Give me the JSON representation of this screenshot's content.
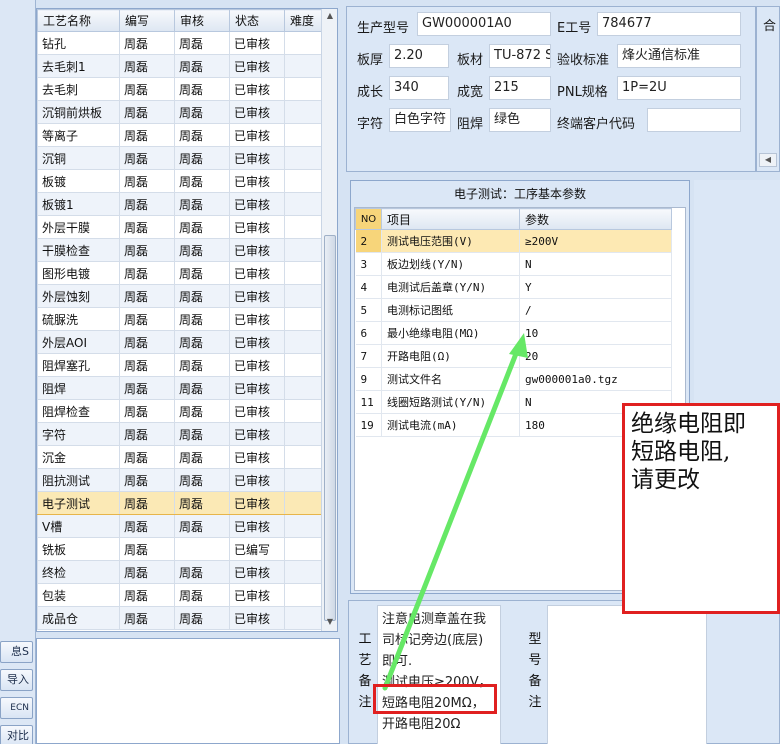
{
  "side_buttons": [
    "息S",
    "导入",
    "ECN",
    "对比"
  ],
  "process_table": {
    "headers": [
      "工艺名称",
      "编写",
      "审核",
      "状态",
      "难度"
    ],
    "rows": [
      [
        "钻孔",
        "周磊",
        "周磊",
        "已审核",
        ""
      ],
      [
        "去毛刺1",
        "周磊",
        "周磊",
        "已审核",
        ""
      ],
      [
        "去毛刺",
        "周磊",
        "周磊",
        "已审核",
        ""
      ],
      [
        "沉铜前烘板",
        "周磊",
        "周磊",
        "已审核",
        ""
      ],
      [
        "等离子",
        "周磊",
        "周磊",
        "已审核",
        ""
      ],
      [
        "沉铜",
        "周磊",
        "周磊",
        "已审核",
        ""
      ],
      [
        "板镀",
        "周磊",
        "周磊",
        "已审核",
        ""
      ],
      [
        "板镀1",
        "周磊",
        "周磊",
        "已审核",
        ""
      ],
      [
        "外层干膜",
        "周磊",
        "周磊",
        "已审核",
        ""
      ],
      [
        "干膜检查",
        "周磊",
        "周磊",
        "已审核",
        ""
      ],
      [
        "图形电镀",
        "周磊",
        "周磊",
        "已审核",
        ""
      ],
      [
        "外层蚀刻",
        "周磊",
        "周磊",
        "已审核",
        ""
      ],
      [
        "硫脲洗",
        "周磊",
        "周磊",
        "已审核",
        ""
      ],
      [
        "外层AOI",
        "周磊",
        "周磊",
        "已审核",
        ""
      ],
      [
        "阻焊塞孔",
        "周磊",
        "周磊",
        "已审核",
        ""
      ],
      [
        "阻焊",
        "周磊",
        "周磊",
        "已审核",
        ""
      ],
      [
        "阻焊检查",
        "周磊",
        "周磊",
        "已审核",
        ""
      ],
      [
        "字符",
        "周磊",
        "周磊",
        "已审核",
        ""
      ],
      [
        "沉金",
        "周磊",
        "周磊",
        "已审核",
        ""
      ],
      [
        "阻抗测试",
        "周磊",
        "周磊",
        "已审核",
        ""
      ],
      [
        "电子测试",
        "周磊",
        "周磊",
        "已审核",
        ""
      ],
      [
        "V槽",
        "周磊",
        "周磊",
        "已审核",
        ""
      ],
      [
        "铣板",
        "周磊",
        "",
        "已编写",
        ""
      ],
      [
        "终检",
        "周磊",
        "周磊",
        "已审核",
        ""
      ],
      [
        "包装",
        "周磊",
        "周磊",
        "已审核",
        ""
      ],
      [
        "成品仓",
        "周磊",
        "周磊",
        "已审核",
        ""
      ]
    ],
    "selected_index": 20
  },
  "info": {
    "model_label": "生产型号",
    "model_value": "GW000001A0",
    "eno_label": "E工号",
    "eno_value": "784677",
    "thick_label": "板厚",
    "thick_value": "2.20",
    "material_label": "板材",
    "material_value": "TU-872 S",
    "standard_label": "验收标准",
    "standard_value": "烽火通信标准",
    "length_label": "成长",
    "length_value": "340",
    "width_label": "成宽",
    "width_value": "215",
    "pnl_label": "PNL规格",
    "pnl_value": "1P=2U",
    "char_label": "字符",
    "char_value": "白色字符",
    "mask_label": "阻焊",
    "mask_value": "绿色",
    "customer_label": "终端客户代码",
    "customer_value": "",
    "cut_label": "合"
  },
  "electronic_test": {
    "title": "电子测试：工序基本参数",
    "headers": [
      "NO",
      "项目",
      "参数"
    ],
    "rows": [
      [
        "2",
        "测试电压范围(V)",
        "≥200V"
      ],
      [
        "3",
        "板边划线(Y/N)",
        "N"
      ],
      [
        "4",
        "电测试后盖章(Y/N)",
        "Y"
      ],
      [
        "5",
        "电测标记图纸",
        "/"
      ],
      [
        "6",
        "最小绝缘电阻(MΩ)",
        "10"
      ],
      [
        "7",
        "开路电阻(Ω)",
        "20"
      ],
      [
        "9",
        "测试文件名",
        "gw000001a0.tgz"
      ],
      [
        "11",
        "线圈短路测试(Y/N)",
        "N"
      ],
      [
        "19",
        "测试电流(mA)",
        "180"
      ]
    ],
    "current_index": 0
  },
  "notes": {
    "process_note_label": [
      "工",
      "艺",
      "备",
      "注"
    ],
    "process_note_lines": [
      "注意电测章盖在我",
      "司标记旁边(底层)",
      "即可.",
      "测试电压≥200V，",
      "短路电阻20MΩ，",
      "开路电阻20Ω"
    ],
    "type_note_label": [
      "型",
      "号",
      "备",
      "注"
    ]
  },
  "annotation": {
    "lines": [
      "绝缘电阻即",
      "短路电阻,",
      "请更改"
    ]
  },
  "colors": {
    "annotation_red": "#e02020",
    "arrow_green": "#66e866",
    "selection": "#fbe9b5"
  }
}
